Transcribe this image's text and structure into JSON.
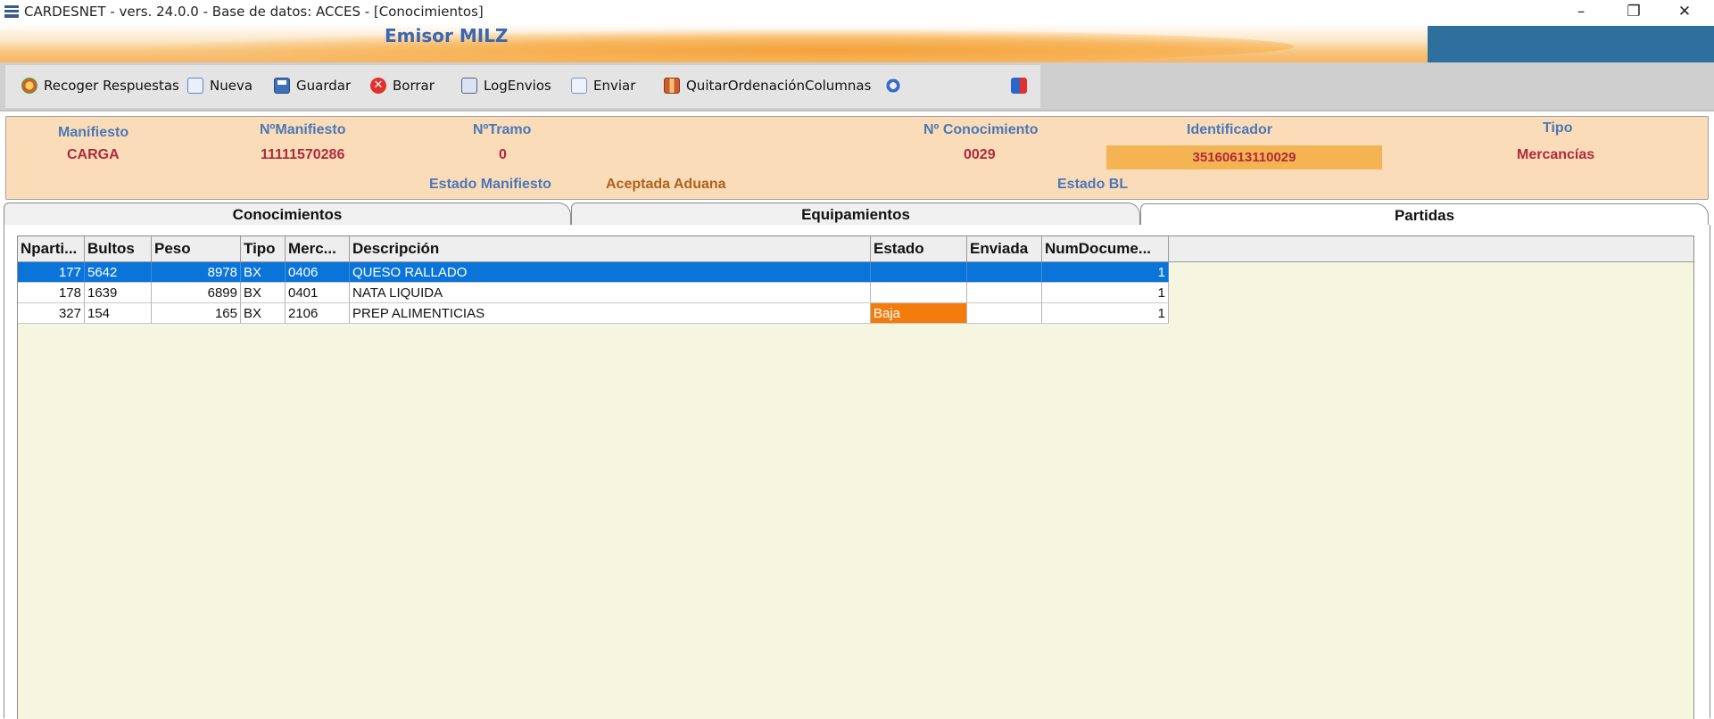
{
  "window": {
    "title": "CARDESNET - vers. 24.0.0 - Base de datos: ACCES - [Conocimientos]",
    "controls": {
      "minimize": "–",
      "restore": "❐",
      "close": "✕"
    }
  },
  "banner": {
    "emisor": "Emisor MILZ"
  },
  "toolbar": {
    "recoger": "Recoger Respuestas",
    "nueva": "Nueva",
    "guardar": "Guardar",
    "borrar": "Borrar",
    "logenvios": "LogEnvios",
    "enviar": "Enviar",
    "quitar": "QuitarOrdenaciónColumnas"
  },
  "header": {
    "manifiesto_label": "Manifiesto",
    "manifiesto_value": "CARGA",
    "nmanifiesto_label": "NºManifiesto",
    "nmanifiesto_value": "11111570286",
    "ntramo_label": "NºTramo",
    "ntramo_value": "0",
    "nconocimiento_label": "Nº Conocimiento",
    "nconocimiento_value": "0029",
    "identificador_label": "Identificador",
    "identificador_value": "35160613110029",
    "tipo_label": "Tipo",
    "tipo_value": "Mercancías",
    "estado_manifiesto_label": "Estado Manifiesto",
    "estado_manifiesto_value": "Aceptada Aduana",
    "estado_bl_label": "Estado BL"
  },
  "tabs": [
    "Conocimientos",
    "Equipamientos",
    "Partidas"
  ],
  "active_tab": "Partidas",
  "grid": {
    "columns": [
      "Nparti...",
      "Bultos",
      "Peso",
      "Tipo",
      "Merc...",
      "Descripción",
      "Estado",
      "Enviada",
      "NumDocume..."
    ],
    "rows": [
      [
        "177",
        "5642",
        "8978",
        "BX",
        "0406",
        "QUESO RALLADO",
        "",
        "",
        "1"
      ],
      [
        "178",
        "1639",
        "6899",
        "BX",
        "0401",
        "NATA LIQUIDA",
        "",
        "",
        "1"
      ],
      [
        "327",
        "154",
        "165",
        "BX",
        "2106",
        "PREP ALIMENTICIAS",
        "Baja",
        "",
        "1"
      ]
    ],
    "selected_row": 0
  },
  "colors": {
    "selection": "#0a74d8",
    "baja": "#f47c0c",
    "panel": "#fbdcb9",
    "grid_bg": "#f6f5df",
    "label_blue": "#4a78b8",
    "value_red": "#b02a3a"
  }
}
